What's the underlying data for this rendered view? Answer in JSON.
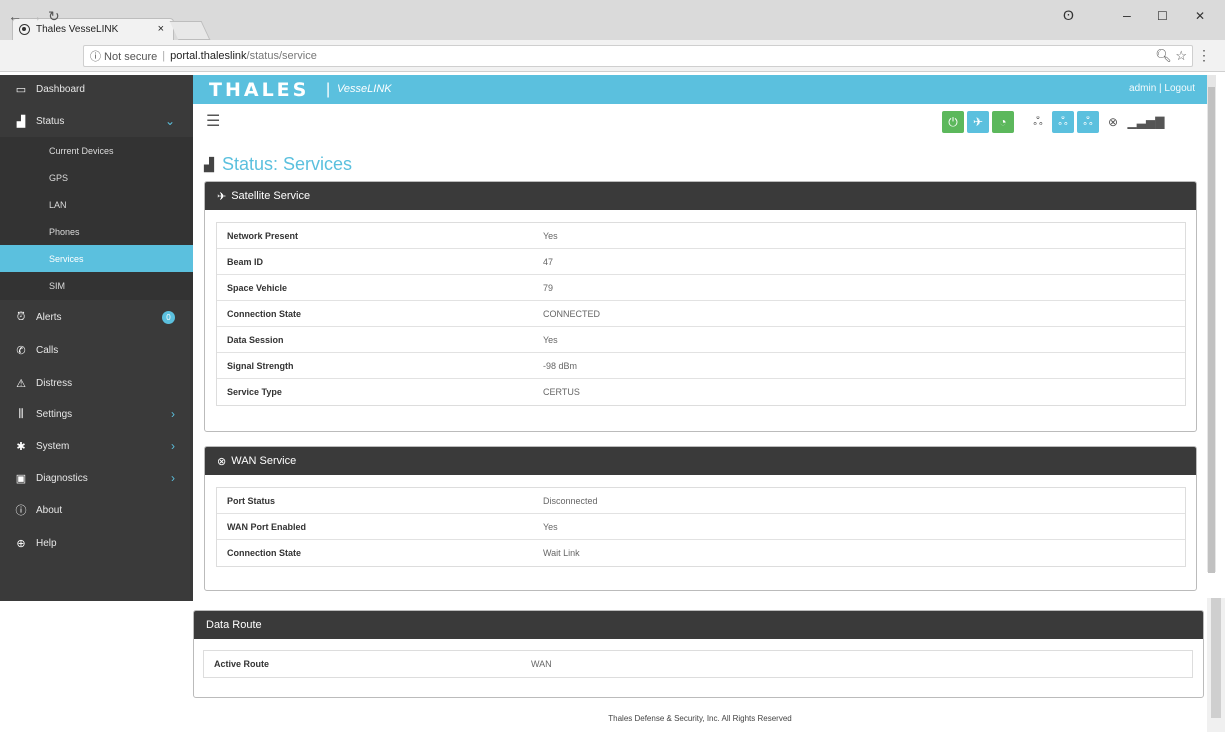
{
  "browser": {
    "tab_title": "Thales VesseLINK",
    "tab_close": "×",
    "security": "ⓘ Not secure",
    "url_host": "portal.thaleslink",
    "url_path": "/status/service",
    "win_user": "ʘ",
    "win_min": "–",
    "win_max": "☐",
    "win_close": "✕"
  },
  "header": {
    "brand": "THALES",
    "separator": "|",
    "product": "VesseLINK",
    "user_links": "admin | Logout"
  },
  "sidebar": {
    "dashboard": "Dashboard",
    "status": "Status",
    "status_sub": [
      "Current Devices",
      "GPS",
      "LAN",
      "Phones",
      "Services",
      "SIM"
    ],
    "alerts": "Alerts",
    "alerts_count": "0",
    "calls": "Calls",
    "distress": "Distress",
    "settings": "Settings",
    "system": "System",
    "diagnostics": "Diagnostics",
    "about": "About",
    "help": "Help"
  },
  "page": {
    "title": "Status: Services"
  },
  "satellite": {
    "title": "Satellite Service",
    "rows": [
      {
        "k": "Network Present",
        "v": "Yes"
      },
      {
        "k": "Beam ID",
        "v": "47"
      },
      {
        "k": "Space Vehicle",
        "v": "79"
      },
      {
        "k": "Connection State",
        "v": "CONNECTED"
      },
      {
        "k": "Data Session",
        "v": "Yes"
      },
      {
        "k": "Signal Strength",
        "v": "-98 dBm"
      },
      {
        "k": "Service Type",
        "v": "CERTUS"
      }
    ]
  },
  "wan": {
    "title": "WAN Service",
    "rows": [
      {
        "k": "Port Status",
        "v": "Disconnected"
      },
      {
        "k": "WAN Port Enabled",
        "v": "Yes"
      },
      {
        "k": "Connection State",
        "v": "Wait Link"
      }
    ]
  },
  "route": {
    "title": "Data Route",
    "rows": [
      {
        "k": "Active Route",
        "v": "WAN"
      }
    ]
  },
  "footer": "Thales Defense & Security, Inc. All Rights Reserved",
  "colors": {
    "accent": "#5bc0de",
    "sidebar": "#3a3a3a",
    "status_ok": "#5cb85c"
  }
}
